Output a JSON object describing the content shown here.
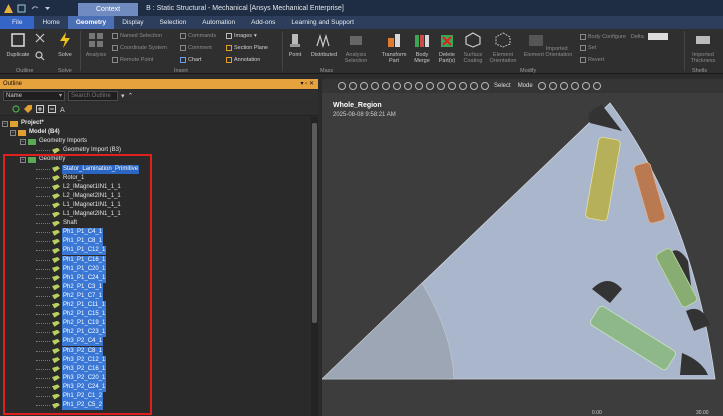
{
  "window": {
    "context_tab": "Context",
    "title": "B : Static Structural - Mechanical [Ansys Mechanical Enterprise]"
  },
  "menu_tabs": [
    "File",
    "Home",
    "Geometry",
    "Display",
    "Selection",
    "Automation",
    "Add-ons",
    "Learning and Support"
  ],
  "ribbon": {
    "duplicate": "Duplicate",
    "solve": "Solve",
    "analysis": "Analysis",
    "named_selection": "Named Selection",
    "coordinate_system": "Coordinate System",
    "remote_point": "Remote Point",
    "commands": "Commands",
    "comment": "Comment",
    "chart": "Chart",
    "images": "Images",
    "section_plane": "Section Plane",
    "annotation": "Annotation",
    "point": "Point",
    "distributed": "Distributed",
    "analysis_selection": "Analysis Selection",
    "transform_part": "Transform Part",
    "body_merge": "Body Merge",
    "delete_parts": "Delete Part(s)",
    "surface_coating": "Surface Coating",
    "element_orientation": "Element Orientation",
    "imported_element_orientation": "Imported Element Orientation",
    "body_configure": "Body Configure",
    "delta": "Delta",
    "set": "Set",
    "revert": "Revert",
    "imported_thickness": "Imported Thickness",
    "groups": {
      "outline": "Outline",
      "solve": "Solve",
      "insert": "Insert",
      "mass": "Mass",
      "modify": "Modify",
      "shells": "Shells"
    }
  },
  "outline": {
    "header": "Outline",
    "filter_value": "Name",
    "search_placeholder": "Search Outline",
    "tree": [
      {
        "label": "Project*",
        "level": 0,
        "state": "bold"
      },
      {
        "label": "Model (B4)",
        "level": 1,
        "state": "bold"
      },
      {
        "label": "Geometry Imports",
        "level": 2,
        "state": ""
      },
      {
        "label": "Geometry Import (B3)",
        "level": 3,
        "state": ""
      },
      {
        "label": "Geometry",
        "level": 2,
        "state": ""
      },
      {
        "label": "Stator_Lamination_Primitive",
        "level": 3,
        "state": "hl"
      },
      {
        "label": "Rotor_1",
        "level": 3,
        "state": ""
      },
      {
        "label": "L2_IMagnet1IN1_1_1",
        "level": 3,
        "state": ""
      },
      {
        "label": "L2_IMagnet2IN1_1_1",
        "level": 3,
        "state": ""
      },
      {
        "label": "L1_IMagnet1IN1_1_1",
        "level": 3,
        "state": ""
      },
      {
        "label": "L1_IMagnet2IN1_1_1",
        "level": 3,
        "state": ""
      },
      {
        "label": "Shaft",
        "level": 3,
        "state": ""
      },
      {
        "label": "Ph1_P1_C4_1",
        "level": 3,
        "state": "sel"
      },
      {
        "label": "Ph1_P1_C8_1",
        "level": 3,
        "state": "sel"
      },
      {
        "label": "Ph1_P1_C12_1",
        "level": 3,
        "state": "sel"
      },
      {
        "label": "Ph1_P1_C16_1",
        "level": 3,
        "state": "sel"
      },
      {
        "label": "Ph1_P1_C20_1",
        "level": 3,
        "state": "sel"
      },
      {
        "label": "Ph1_P1_C24_1",
        "level": 3,
        "state": "sel"
      },
      {
        "label": "Ph2_P1_C3_1",
        "level": 3,
        "state": "sel"
      },
      {
        "label": "Ph2_P1_C7_1",
        "level": 3,
        "state": "sel"
      },
      {
        "label": "Ph2_P1_C11_1",
        "level": 3,
        "state": "sel"
      },
      {
        "label": "Ph2_P1_C15_1",
        "level": 3,
        "state": "sel"
      },
      {
        "label": "Ph2_P1_C19_1",
        "level": 3,
        "state": "sel"
      },
      {
        "label": "Ph2_P1_C23_1",
        "level": 3,
        "state": "sel"
      },
      {
        "label": "Ph3_P2_C4_1",
        "level": 3,
        "state": "sel"
      },
      {
        "label": "Ph3_P2_C8_1",
        "level": 3,
        "state": "sel"
      },
      {
        "label": "Ph3_P2_C12_1",
        "level": 3,
        "state": "sel"
      },
      {
        "label": "Ph3_P2_C16_1",
        "level": 3,
        "state": "sel"
      },
      {
        "label": "Ph3_P2_C20_1",
        "level": 3,
        "state": "sel"
      },
      {
        "label": "Ph3_P2_C24_1",
        "level": 3,
        "state": "sel"
      },
      {
        "label": "Ph1_P2_C1_2",
        "level": 3,
        "state": "sel"
      },
      {
        "label": "Ph1_P2_C5_2",
        "level": 3,
        "state": "sel"
      }
    ]
  },
  "graphics": {
    "title": "Whole_Region",
    "timestamp": "2025-08-08 9:58:21 AM",
    "select_label": "Select",
    "mode_label": "Mode",
    "scale_left": "0.00",
    "scale_right": "30.00"
  },
  "colors": {
    "selection": "#3b78d6",
    "outline_header": "#e6a23c",
    "annotation_red": "#e0201f",
    "region_fill": "#a9b6cc",
    "coil_yellow": "#b6b05a",
    "coil_orange": "#b97a52",
    "coil_green": "#88ad72"
  }
}
